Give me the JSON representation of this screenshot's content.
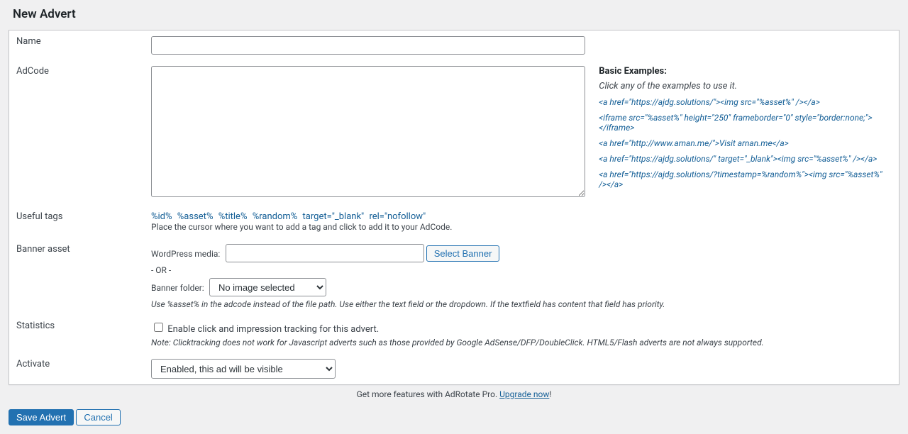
{
  "heading": "New Advert",
  "rows": {
    "name": {
      "label": "Name"
    },
    "adcode": {
      "label": "AdCode"
    },
    "usefultags": {
      "label": "Useful tags"
    },
    "banner": {
      "label": "Banner asset"
    },
    "statistics": {
      "label": "Statistics"
    },
    "activate": {
      "label": "Activate"
    }
  },
  "examples": {
    "title": "Basic Examples:",
    "hint": "Click any of the examples to use it.",
    "list": [
      "<a href=\"https://ajdg.solutions/\"><img src=\"%asset%\" /></a>",
      "<iframe src=\"%asset%\" height=\"250\" frameborder=\"0\" style=\"border:none;\"></iframe>",
      "<a href=\"http://www.arnan.me/\">Visit arnan.me</a>",
      "<a href=\"https://ajdg.solutions/\" target=\"_blank\"><img src=\"%asset%\" /></a>",
      "<a href=\"https://ajdg.solutions/?timestamp=%random%\"><img src=\"%asset%\" /></a>"
    ]
  },
  "tags": {
    "list": [
      "%id%",
      "%asset%",
      "%title%",
      "%random%",
      "target=\"_blank\"",
      "rel=\"nofollow\""
    ],
    "desc": "Place the cursor where you want to add a tag and click to add it to your AdCode."
  },
  "banner": {
    "wp_label": "WordPress media:",
    "select_button": "Select Banner",
    "or": "- OR -",
    "folder_label": "Banner folder:",
    "folder_option": "No image selected",
    "note": "Use %asset% in the adcode instead of the file path. Use either the text field or the dropdown. If the textfield has content that field has priority."
  },
  "statistics": {
    "checkbox": "Enable click and impression tracking for this advert.",
    "note": "Note: Clicktracking does not work for Javascript adverts such as those provided by Google AdSense/DFP/DoubleClick. HTML5/Flash adverts are not always supported."
  },
  "activate": {
    "option": "Enabled, this ad will be visible"
  },
  "upgrade": {
    "text": "Get more features with AdRotate Pro. ",
    "link": "Upgrade now",
    "bang": "!"
  },
  "actions": {
    "save": "Save Advert",
    "cancel": "Cancel"
  }
}
